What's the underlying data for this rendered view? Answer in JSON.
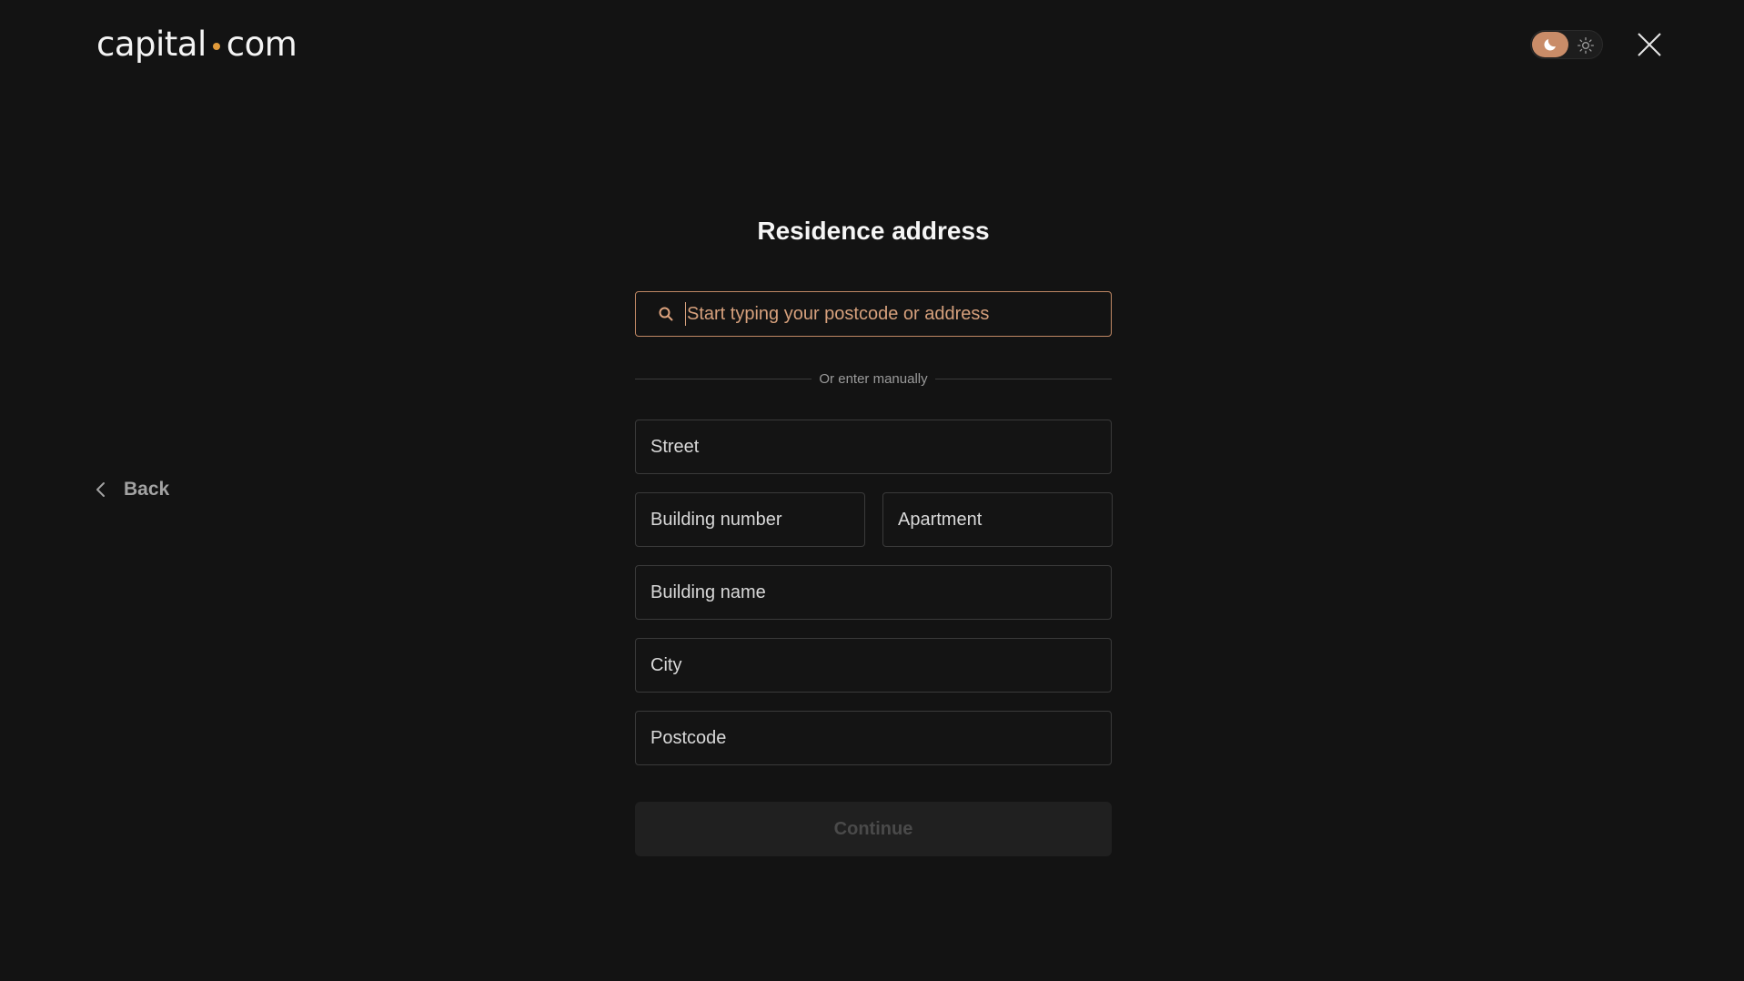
{
  "header": {
    "logo_left": "capital",
    "logo_right": "com",
    "theme_toggle": {
      "active": "dark",
      "icons": [
        "moon-icon",
        "sun-icon"
      ]
    },
    "close_icon": "close-icon"
  },
  "nav": {
    "back_label": "Back"
  },
  "form": {
    "title": "Residence address",
    "search_placeholder": "Start typing your postcode or address",
    "divider_label": "Or enter manually",
    "fields": {
      "street": "Street",
      "building_number": "Building number",
      "apartment": "Apartment",
      "building_name": "Building name",
      "city": "City",
      "postcode": "Postcode"
    },
    "continue_label": "Continue"
  },
  "colors": {
    "background": "#131313",
    "accent": "#c98c68",
    "logo_dot": "#e19a3a"
  }
}
